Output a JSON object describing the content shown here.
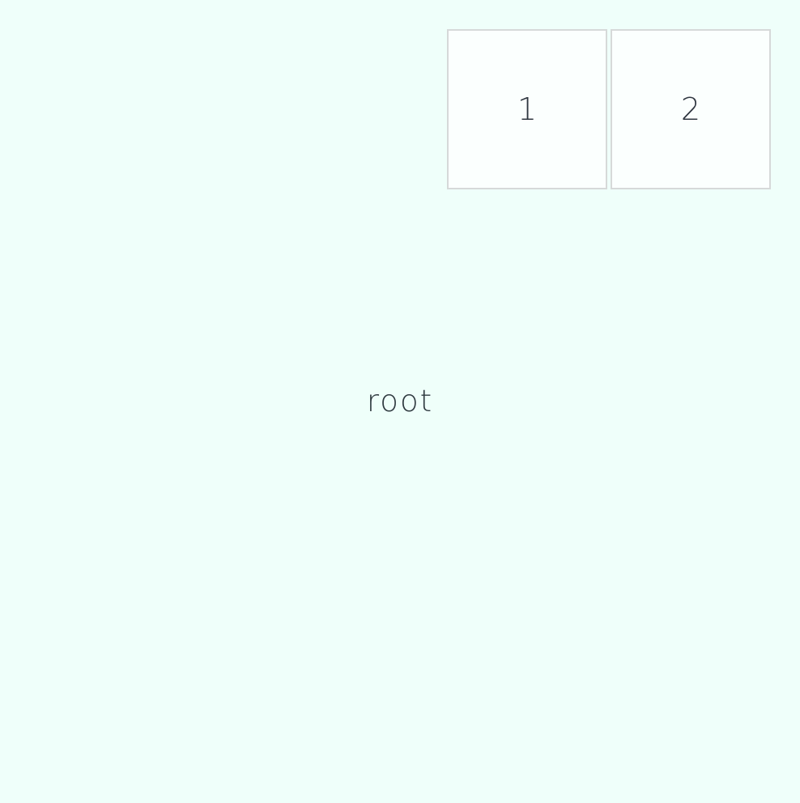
{
  "root": {
    "label": "root"
  },
  "cells": [
    {
      "label": "1"
    },
    {
      "label": "2"
    }
  ],
  "colors": {
    "background": "#effffa",
    "cell_background": "#fbfffe",
    "cell_border": "#d6d9d9",
    "text": "#2f3640"
  }
}
